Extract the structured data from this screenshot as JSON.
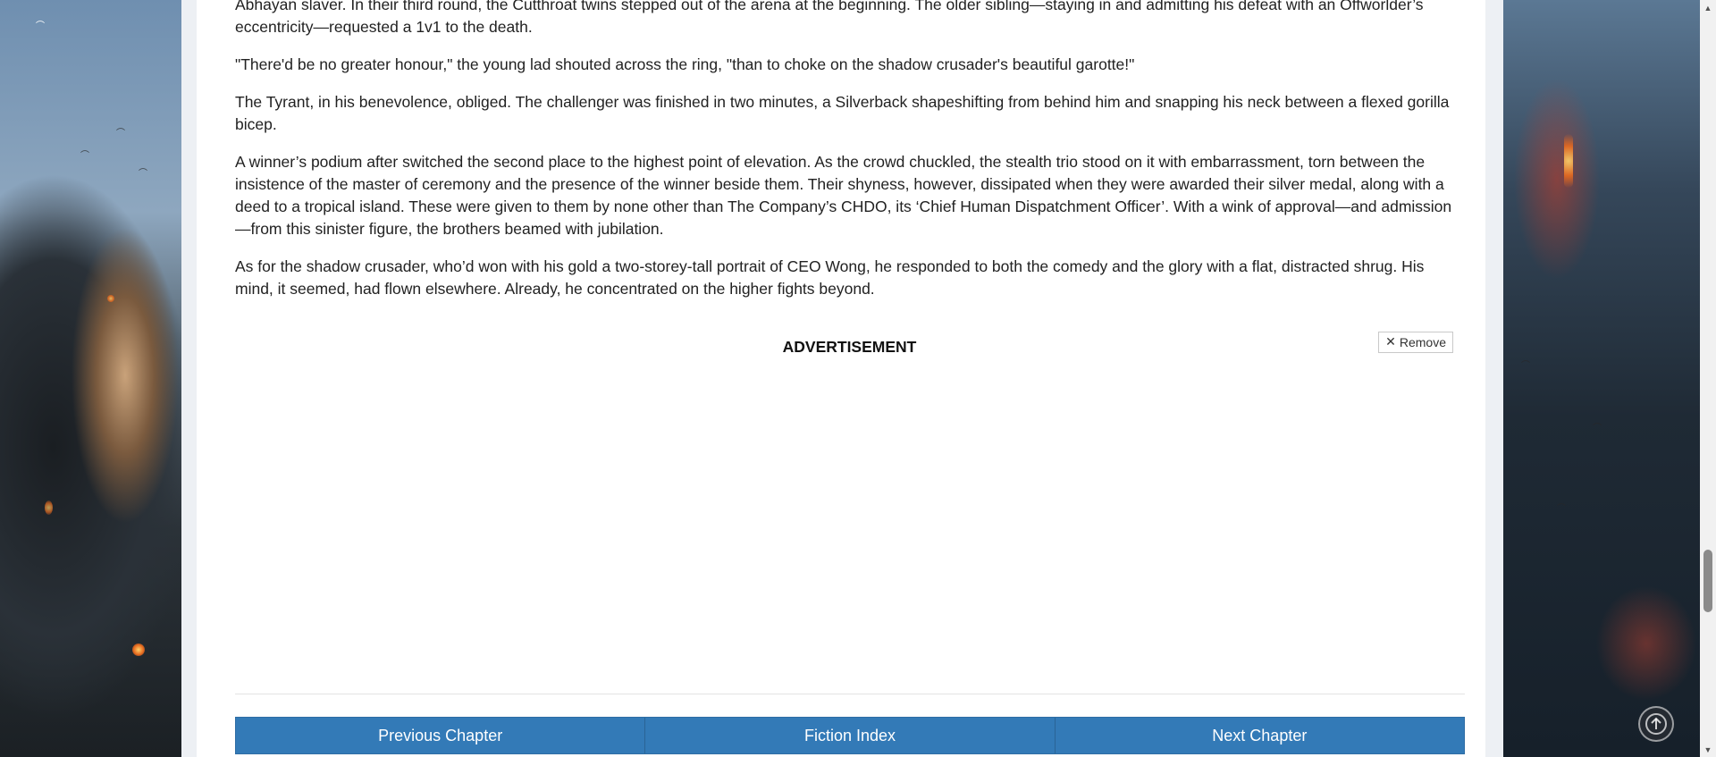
{
  "chapter": {
    "paragraphs": [
      "Abhayan slaver. In their third round, the Cutthroat twins stepped out of the arena at the beginning. The older sibling—staying in and admitting his defeat with an Offworlder’s eccentricity—requested a 1v1 to the death.",
      "\"There'd be no greater honour,\" the young lad shouted across the ring, \"than to choke on the shadow crusader's beautiful garotte!\"",
      "The Tyrant, in his benevolence, obliged. The challenger was finished in two minutes, a Silverback shapeshifting from behind him and snapping his neck between a flexed gorilla bicep.",
      "A winner’s podium after switched the second place to the highest point of elevation. As the crowd chuckled, the stealth trio stood on it with embarrassment, torn between the insistence of the master of ceremony and the presence of the winner beside them. Their shyness, however, dissipated when they were awarded their silver medal, along with a deed to a tropical island. These were given to them by none other than The Company’s CHDO, its ‘Chief Human Dispatchment Officer’. With a wink of approval—and admission—from this sinister figure, the brothers beamed with jubilation.",
      "As for the shadow crusader, who’d won with his gold a two-storey-tall portrait of CEO Wong, he responded to both the comedy and the glory with a flat, distracted shrug. His mind, it seemed, had flown elsewhere. Already, he concentrated on the higher fights beyond."
    ]
  },
  "advertisement": {
    "label": "ADVERTISEMENT",
    "remove_label": "Remove",
    "remove_icon": "close-icon"
  },
  "navigation": {
    "previous_label": "Previous Chapter",
    "index_label": "Fiction Index",
    "next_label": "Next Chapter"
  },
  "widgets": {
    "scroll_to_top_icon": "arrow-up-circle-icon"
  },
  "colors": {
    "nav_button_bg": "#337ab7",
    "page_bg": "#ffffff"
  }
}
